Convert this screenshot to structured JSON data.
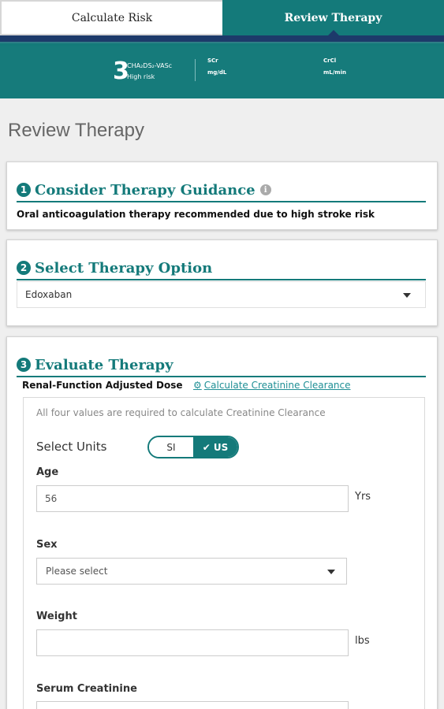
{
  "tabs": {
    "calculate_risk": "Calculate Risk",
    "review_therapy": "Review Therapy"
  },
  "summary": {
    "score": "3",
    "score_label": "CHA₂DS₂-VASc",
    "risk_level": "High risk",
    "scr_label": "SCr",
    "scr_unit": "mg/dL",
    "crcl_label": "CrCl",
    "crcl_unit": "mL/min"
  },
  "page": {
    "title": "Review Therapy"
  },
  "section1": {
    "number": "1",
    "title": "Consider Therapy Guidance",
    "info_glyph": "i",
    "guidance_text": "Oral anticoagulation therapy recommended due to high stroke risk"
  },
  "section2": {
    "number": "2",
    "title": "Select Therapy Option",
    "selected_option": "Edoxaban"
  },
  "section3": {
    "number": "3",
    "title": "Evaluate Therapy",
    "renal_label": "Renal-Function Adjusted Dose",
    "calc_link": "Calculate Creatinine Clearance",
    "required_note": "All four values are required to calculate Creatinine Clearance",
    "units_label": "Select Units",
    "unit_si": "SI",
    "unit_us": "✔ US",
    "age_label": "Age",
    "age_value": "56",
    "age_unit": "Yrs",
    "sex_label": "Sex",
    "sex_placeholder": "Please select",
    "weight_label": "Weight",
    "weight_value": "",
    "weight_unit": "lbs",
    "serum_label": "Serum Creatinine"
  },
  "colors": {
    "teal": "#147a7a",
    "navy": "#1d3a6a",
    "link": "#1f8f95"
  }
}
